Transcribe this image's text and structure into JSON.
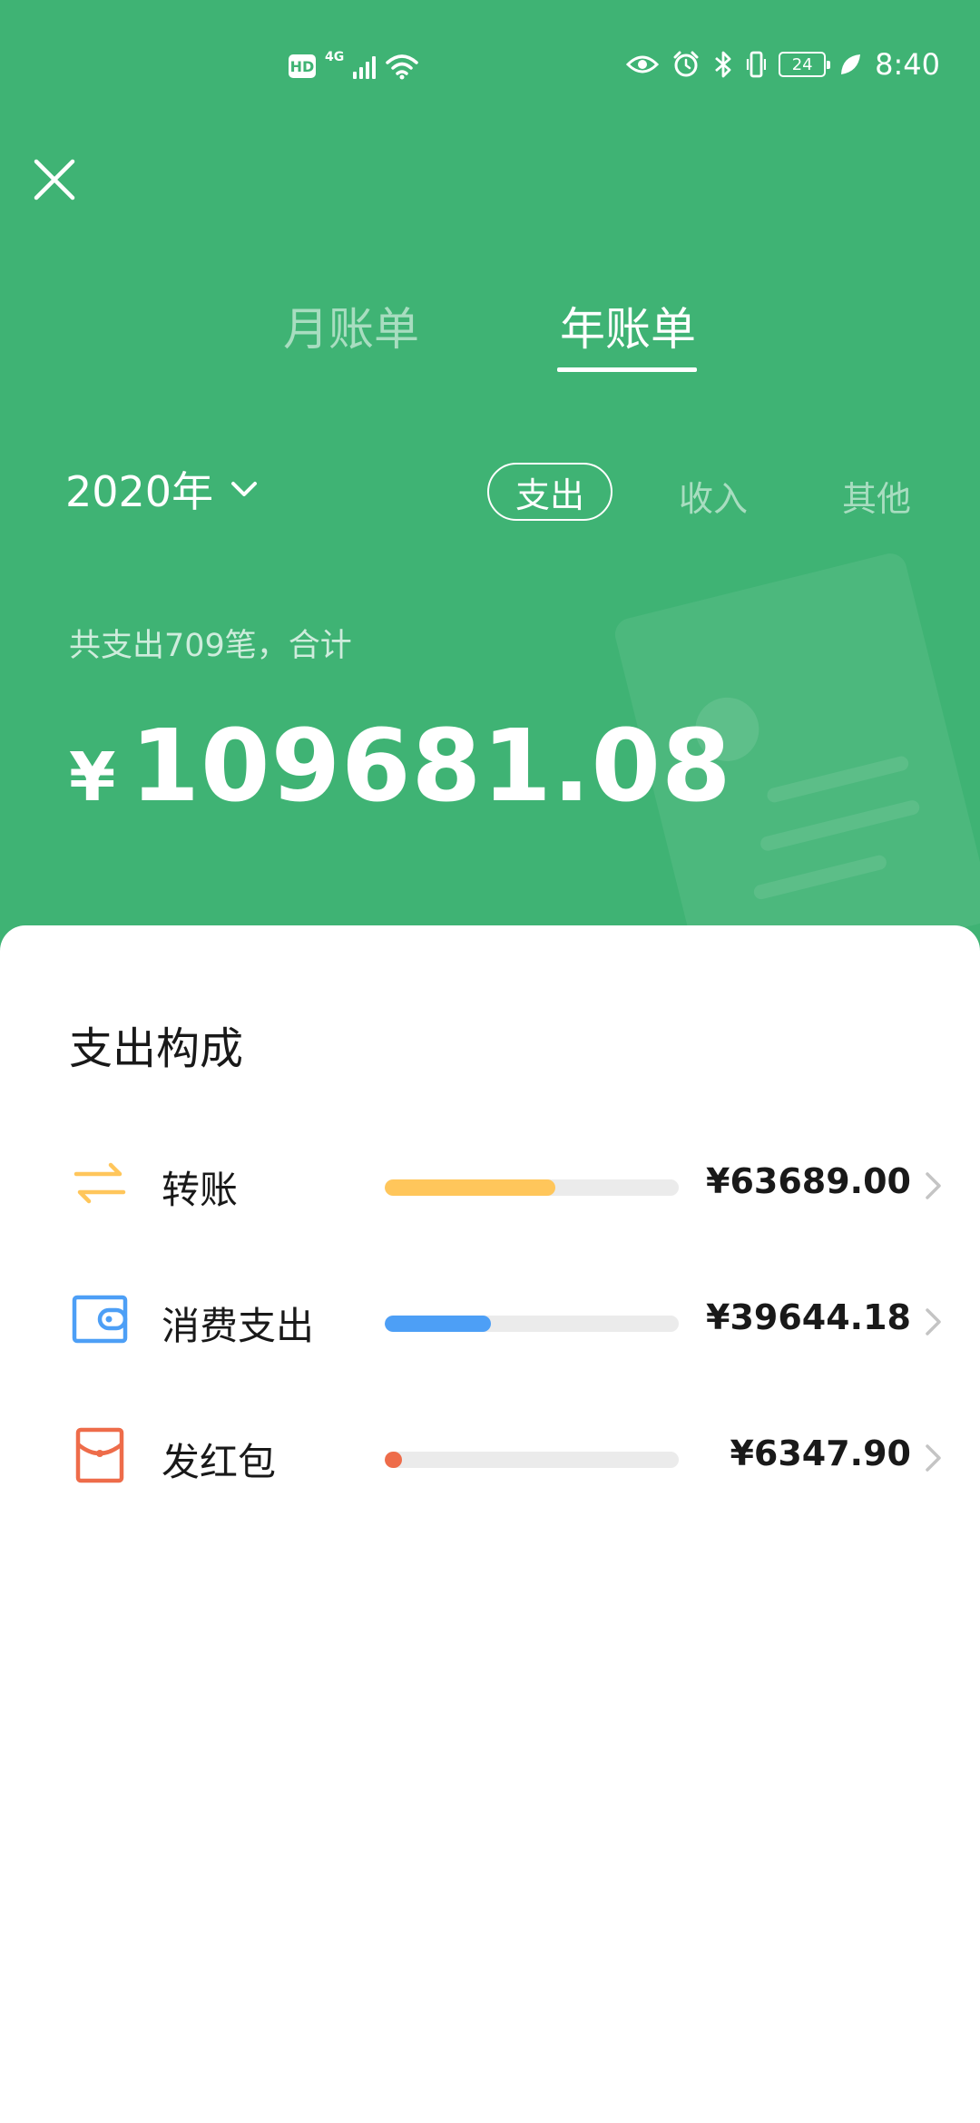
{
  "status_bar": {
    "hd": "HD",
    "network": "4G",
    "battery": "24",
    "time": "8:40"
  },
  "tabs": [
    {
      "label": "月账单",
      "active": false
    },
    {
      "label": "年账单",
      "active": true
    }
  ],
  "year_selector": {
    "label": "2020年"
  },
  "type_chips": [
    {
      "label": "支出",
      "selected": true
    },
    {
      "label": "收入",
      "selected": false
    },
    {
      "label": "其他",
      "selected": false
    }
  ],
  "summary": {
    "text": "共支出709笔，合计",
    "currency": "¥",
    "total": "109681.08"
  },
  "breakdown": {
    "title": "支出构成",
    "items": [
      {
        "label": "转账",
        "amount": "¥63689.00",
        "fraction": 0.58,
        "color": "#ffc65b",
        "icon": "transfer-icon"
      },
      {
        "label": "消费支出",
        "amount": "¥39644.18",
        "fraction": 0.36,
        "color": "#4d9ff6",
        "icon": "wallet-icon"
      },
      {
        "label": "发红包",
        "amount": "¥6347.90",
        "fraction": 0.06,
        "color": "#ee6c4a",
        "icon": "red-packet-icon"
      }
    ]
  },
  "colors": {
    "header_green": "#3fb374",
    "text_dark": "#191919"
  }
}
